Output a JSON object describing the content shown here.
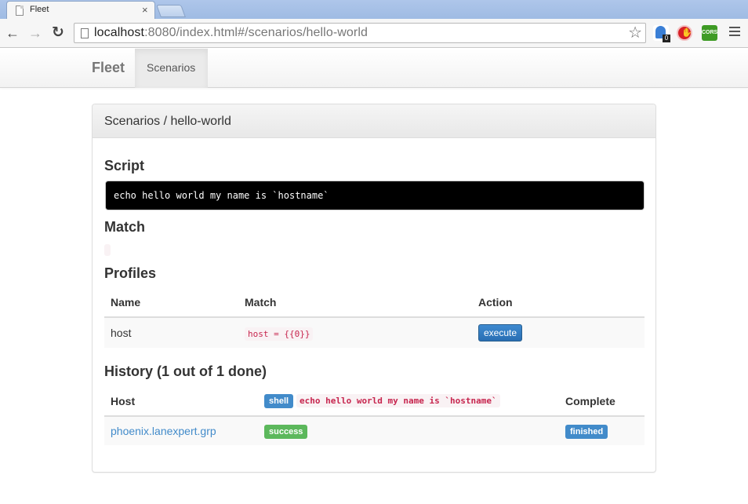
{
  "browser": {
    "tab_title": "Fleet",
    "tab_close": "×",
    "url_host": "localhost",
    "url_rest": ":8080/index.html#/scenarios/hello-world",
    "ext_badge": "0",
    "ext_cors": "CORS"
  },
  "navbar": {
    "brand": "Fleet",
    "items": [
      {
        "label": "Scenarios",
        "active": true
      }
    ]
  },
  "panel": {
    "heading": "Scenarios / hello-world",
    "script_title": "Script",
    "script_text": "echo hello world my name is `hostname`",
    "match_title": "Match",
    "match_value": "",
    "profiles_title": "Profiles",
    "profiles_table": {
      "headers": [
        "Name",
        "Match",
        "Action"
      ],
      "rows": [
        {
          "name": "host",
          "match": "host = {{0}}",
          "action": "execute"
        }
      ]
    },
    "history_title": "History (1 out of 1 done)",
    "history_table": {
      "headers": {
        "host": "Host",
        "type": "shell",
        "command": "echo hello world my name is `hostname`",
        "complete": "Complete"
      },
      "rows": [
        {
          "host": "phoenix.lanexpert.grp",
          "status": "success",
          "complete": "finished"
        }
      ]
    }
  },
  "colors": {
    "primary": "#428bca",
    "success": "#5cb85c",
    "code": "#c7254e"
  }
}
